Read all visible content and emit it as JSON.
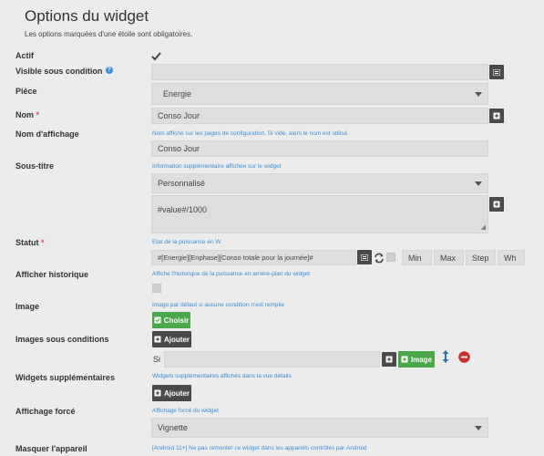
{
  "page": {
    "title": "Options du widget",
    "subtitle": "Les options marquées d'une étoile sont obligatoires."
  },
  "colors": {
    "accent": "#3b8fd9",
    "required": "#d9534f",
    "success": "#4aa84a",
    "dark_button": "#4a4a4a",
    "danger": "#c9302c"
  },
  "actif": {
    "label": "Actif",
    "checked": true
  },
  "visible": {
    "label": "Visible sous condition",
    "value": ""
  },
  "piece": {
    "label": "Pièce",
    "value": "Energie"
  },
  "nom": {
    "label": "Nom",
    "required_mark": "*",
    "value": "Conso Jour"
  },
  "nom_affichage": {
    "label": "Nom d'affichage",
    "help": "Nom affiché sur les pages de configuration. Si vide, alors le nom est utilisé.",
    "value": "Conso Jour"
  },
  "sous_titre": {
    "label": "Sous-titre",
    "help": "Information supplémentaire affichée sur le widget",
    "select_value": "Personnalisé",
    "text_value": "#value#/1000"
  },
  "statut": {
    "label": "Statut",
    "required_mark": "*",
    "help": "Etat de la puissance en W",
    "value": "#[Energie][Enphase][Conso totale pour la journée]#",
    "min_placeholder": "Min",
    "max_placeholder": "Max",
    "step_placeholder": "Step",
    "unit_placeholder": "Wh"
  },
  "historique": {
    "label": "Afficher historique",
    "help": "Affiche l'historique de la puissance en arrière-plan du widget",
    "checked": false
  },
  "image": {
    "label": "Image",
    "help": "Image par défaut si aucune condition n'est remplie",
    "button": "Choisir"
  },
  "images_conditions": {
    "label": "Images sous conditions",
    "button": "Ajouter",
    "si_label": "Si",
    "value": "",
    "image_button": "Image"
  },
  "widgets_supp": {
    "label": "Widgets supplémentaires",
    "help": "Widgets supplémentaires affichés dans la vue détails",
    "button": "Ajouter"
  },
  "affichage_force": {
    "label": "Affichage forcé",
    "help": "Affichage forcé du widget",
    "value": "Vignette"
  },
  "masquer": {
    "label": "Masquer l'appareil",
    "help": "[Android 11+] Ne pas remonter ce widget dans les appareils contrôlés par Android"
  }
}
